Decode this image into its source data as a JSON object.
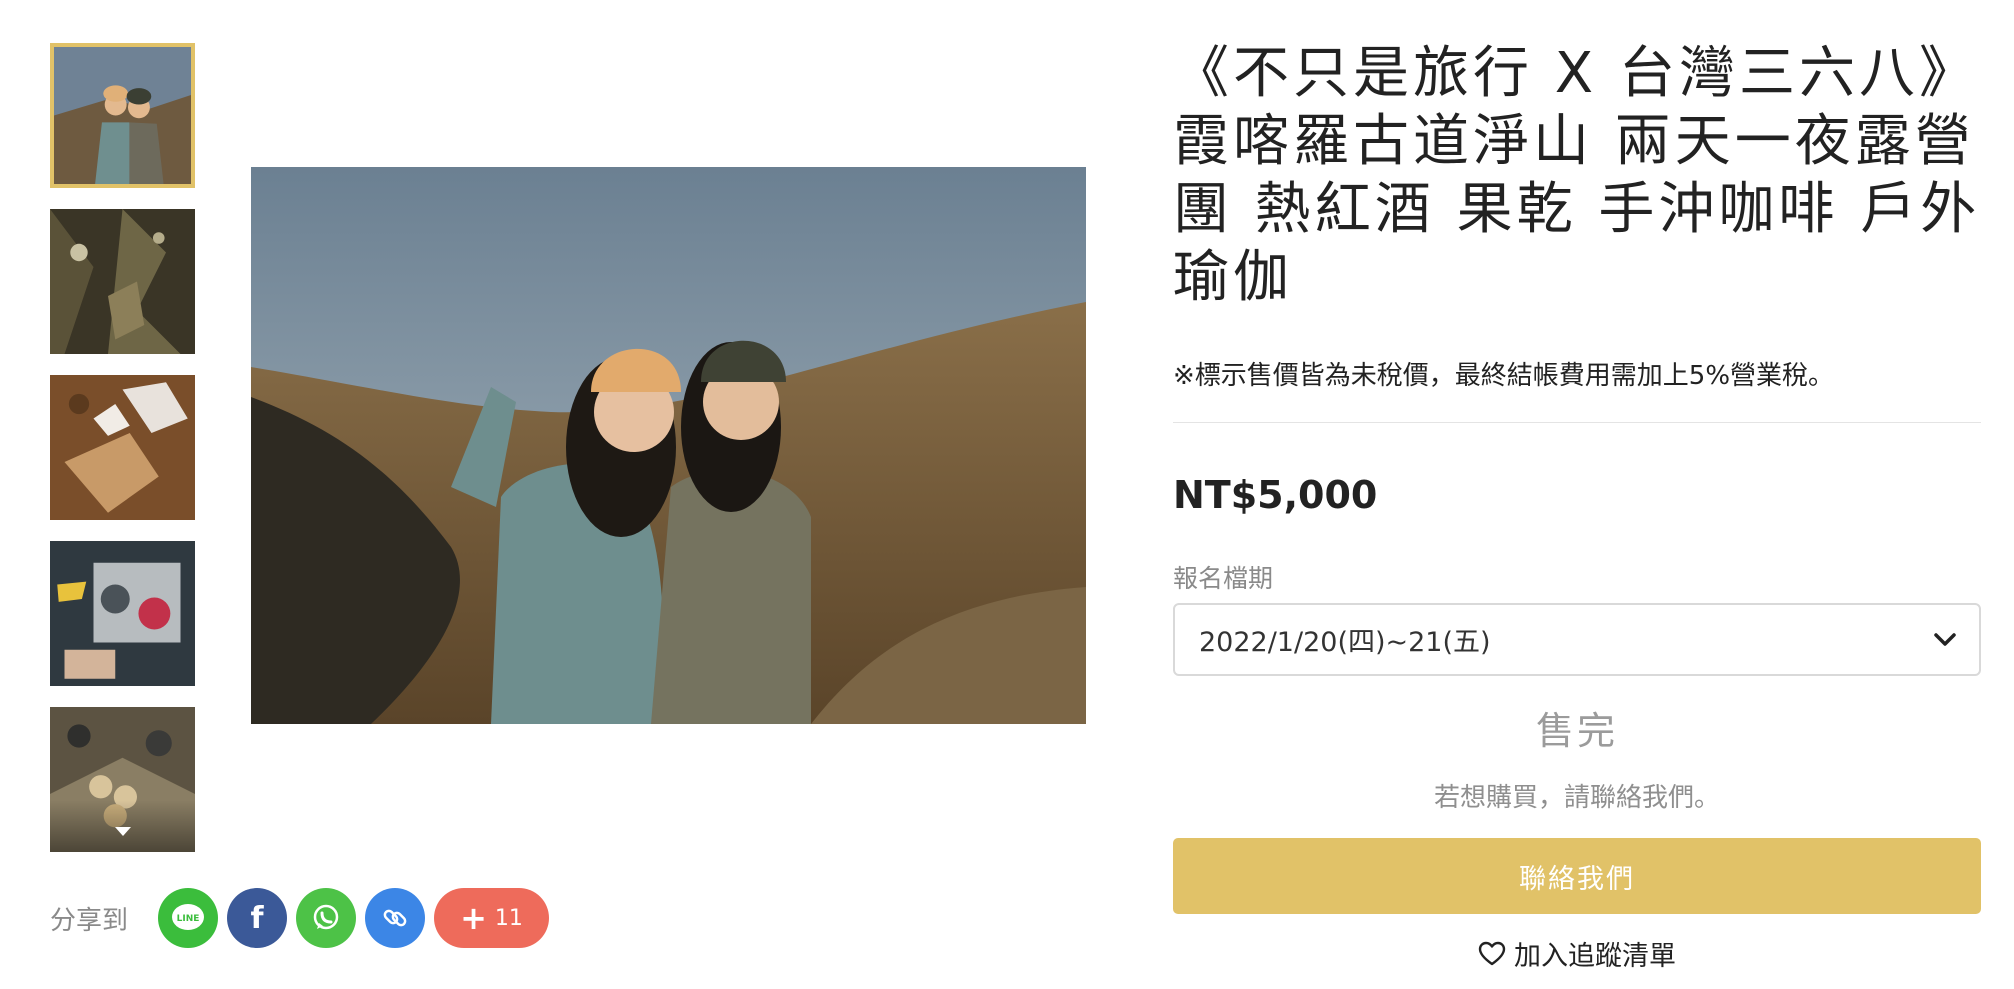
{
  "product": {
    "title": "《不只是旅行 X 台灣三六八》霞喀羅古道淨山 兩天一夜露營團 熱紅酒 果乾 手沖咖啡 戶外瑜伽",
    "tax_note": "※標示售價皆為未稅價，最終結帳費用需加上5%營業稅。",
    "price": "NT$5,000",
    "period_label": "報名檔期",
    "period_selected": "2022/1/20(四)~21(五)",
    "sold_out": "售完",
    "contact_note": "若想購買，請聯絡我們。",
    "contact_button": "聯絡我們",
    "wishlist": "加入追蹤清單"
  },
  "share": {
    "label": "分享到",
    "buttons": [
      {
        "name": "line",
        "text": "LINE",
        "color": "#3bbd3c"
      },
      {
        "name": "facebook",
        "text": "f",
        "color": "#3b5998"
      },
      {
        "name": "whatsapp",
        "text": "",
        "color": "#4dc247"
      },
      {
        "name": "copy-link",
        "text": "",
        "color": "#3c86e6"
      }
    ],
    "more_count": "11",
    "more_color": "#ee6b5b"
  },
  "colors": {
    "accent": "#e1c268",
    "sold_out_text": "#9b9b9b"
  },
  "gallery": {
    "thumbnail_count": 5,
    "active_index": 0
  }
}
